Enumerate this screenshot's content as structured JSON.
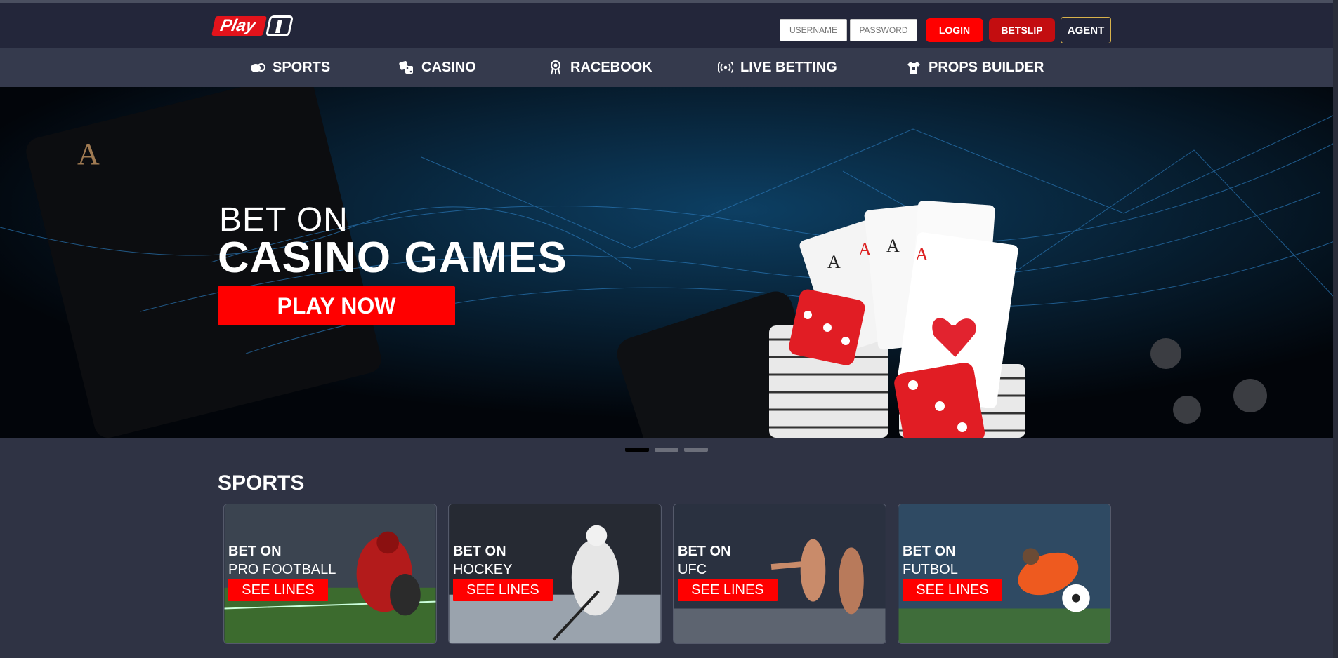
{
  "header": {
    "logo_text": "Play",
    "username_placeholder": "USERNAME",
    "password_placeholder": "PASSWORD",
    "login_label": "LOGIN",
    "betslip_label": "BETSLIP",
    "agent_label": "AGENT"
  },
  "nav": {
    "items": [
      {
        "label": "SPORTS",
        "icon": "sports-icon"
      },
      {
        "label": "CASINO",
        "icon": "dice-icon"
      },
      {
        "label": "RACEBOOK",
        "icon": "horse-icon"
      },
      {
        "label": "LIVE BETTING",
        "icon": "broadcast-icon"
      },
      {
        "label": "PROPS BUILDER",
        "icon": "jersey-icon"
      }
    ]
  },
  "hero": {
    "line1": "BET ON",
    "line2": "CASINO GAMES",
    "cta": "PLAY NOW",
    "slides_total": 3,
    "active_slide": 1
  },
  "sports": {
    "title": "SPORTS",
    "cards": [
      {
        "line1": "BET ON",
        "line2": "PRO FOOTBALL",
        "cta": "SEE LINES"
      },
      {
        "line1": "BET ON",
        "line2": "HOCKEY",
        "cta": "SEE LINES"
      },
      {
        "line1": "BET ON",
        "line2": "UFC",
        "cta": "SEE LINES"
      },
      {
        "line1": "BET ON",
        "line2": "FUTBOL",
        "cta": "SEE LINES"
      }
    ]
  },
  "colors": {
    "accent_red": "#ff0000",
    "header_bg": "#23263a",
    "nav_bg": "#353a4d",
    "page_bg": "#2f3344",
    "agent_border": "#d8b24b"
  }
}
